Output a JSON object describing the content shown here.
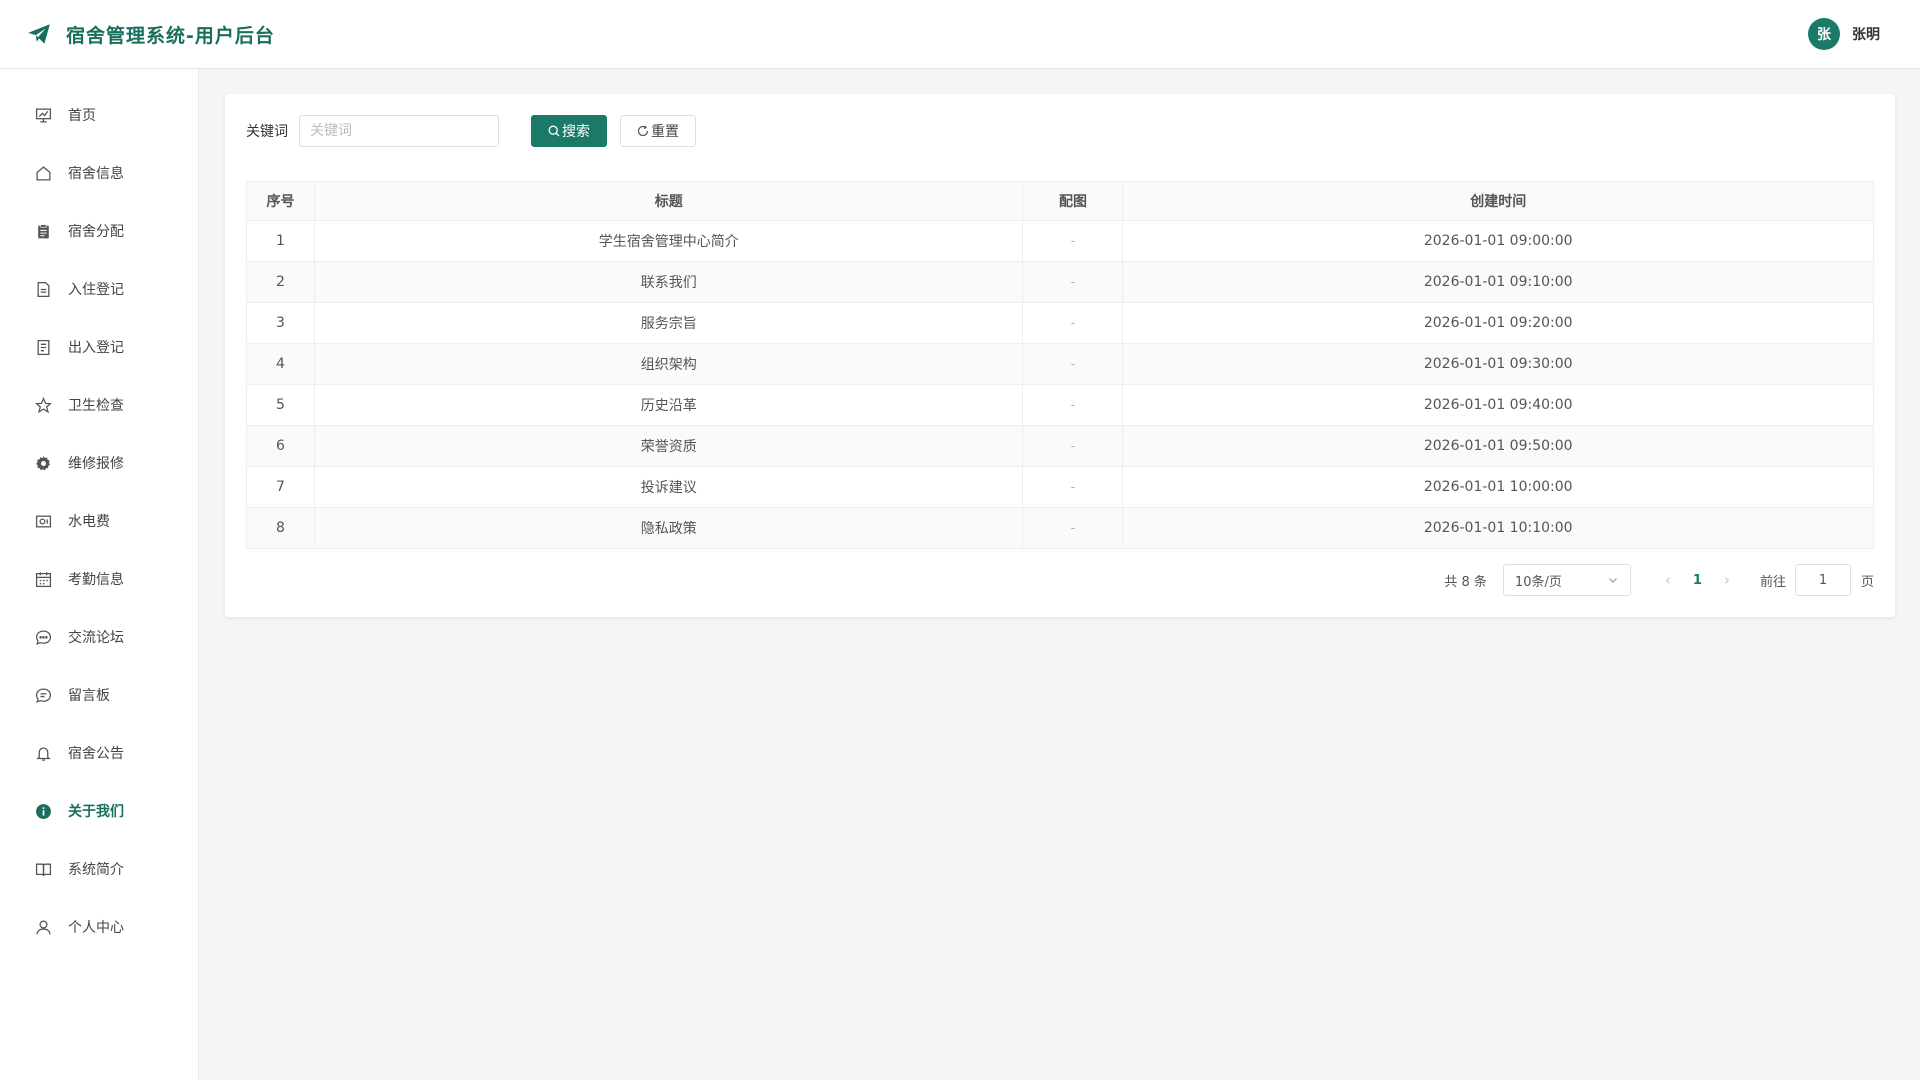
{
  "header": {
    "title": "宿舍管理系统-用户后台",
    "user_avatar": "张",
    "user_name": "张明",
    "brand_color": "#1a6e5e"
  },
  "sidebar": {
    "items": [
      {
        "label": "首页",
        "icon": "chart-icon"
      },
      {
        "label": "宿舍信息",
        "icon": "home-icon"
      },
      {
        "label": "宿舍分配",
        "icon": "clipboard-icon"
      },
      {
        "label": "入住登记",
        "icon": "document-icon"
      },
      {
        "label": "出入登记",
        "icon": "list-document-icon"
      },
      {
        "label": "卫生检查",
        "icon": "star-icon"
      },
      {
        "label": "维修报修",
        "icon": "gear-icon"
      },
      {
        "label": "水电费",
        "icon": "money-icon"
      },
      {
        "label": "考勤信息",
        "icon": "calendar-icon"
      },
      {
        "label": "交流论坛",
        "icon": "chat-dots-icon"
      },
      {
        "label": "留言板",
        "icon": "chat-line-icon"
      },
      {
        "label": "宿舍公告",
        "icon": "bell-icon"
      },
      {
        "label": "关于我们",
        "icon": "info-icon",
        "active": true
      },
      {
        "label": "系统简介",
        "icon": "book-icon"
      },
      {
        "label": "个人中心",
        "icon": "user-icon"
      }
    ]
  },
  "search": {
    "label": "关键词",
    "placeholder": "关键词",
    "value": "",
    "search_button": "搜索",
    "reset_button": "重置"
  },
  "table": {
    "headers": [
      "序号",
      "标题",
      "配图",
      "创建时间"
    ],
    "rows": [
      {
        "index": "1",
        "title": "学生宿舍管理中心简介",
        "image": "-",
        "created": "2026-01-01 09:00:00"
      },
      {
        "index": "2",
        "title": "联系我们",
        "image": "-",
        "created": "2026-01-01 09:10:00"
      },
      {
        "index": "3",
        "title": "服务宗旨",
        "image": "-",
        "created": "2026-01-01 09:20:00"
      },
      {
        "index": "4",
        "title": "组织架构",
        "image": "-",
        "created": "2026-01-01 09:30:00"
      },
      {
        "index": "5",
        "title": "历史沿革",
        "image": "-",
        "created": "2026-01-01 09:40:00"
      },
      {
        "index": "6",
        "title": "荣誉资质",
        "image": "-",
        "created": "2026-01-01 09:50:00"
      },
      {
        "index": "7",
        "title": "投诉建议",
        "image": "-",
        "created": "2026-01-01 10:00:00"
      },
      {
        "index": "8",
        "title": "隐私政策",
        "image": "-",
        "created": "2026-01-01 10:10:00"
      }
    ]
  },
  "pagination": {
    "total": "共 8 条",
    "page_size": "10条/页",
    "current_page": "1",
    "goto_label": "前往",
    "goto_value": "1",
    "page_unit": "页"
  }
}
